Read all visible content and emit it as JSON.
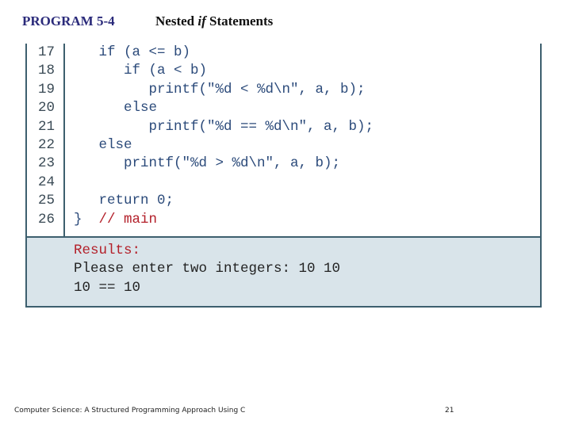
{
  "header": {
    "program_label": "PROGRAM 5-4",
    "title_prefix": "Nested ",
    "title_keyword": "if",
    "title_suffix": " Statements"
  },
  "code": {
    "lines": [
      {
        "num": "17",
        "text": "   if (a <= b)",
        "comment": ""
      },
      {
        "num": "18",
        "text": "      if (a < b)",
        "comment": ""
      },
      {
        "num": "19",
        "text": "         printf(\"%d < %d\\n\", a, b);",
        "comment": ""
      },
      {
        "num": "20",
        "text": "      else",
        "comment": ""
      },
      {
        "num": "21",
        "text": "         printf(\"%d == %d\\n\", a, b);",
        "comment": ""
      },
      {
        "num": "22",
        "text": "   else",
        "comment": ""
      },
      {
        "num": "23",
        "text": "      printf(\"%d > %d\\n\", a, b);",
        "comment": ""
      },
      {
        "num": "24",
        "text": "",
        "comment": ""
      },
      {
        "num": "25",
        "text": "   return 0;",
        "comment": ""
      },
      {
        "num": "26",
        "text": "}  ",
        "comment": "// main"
      }
    ]
  },
  "results": {
    "label": "Results:",
    "lines": [
      "Please enter two integers: 10 10",
      "10 == 10"
    ]
  },
  "footer": {
    "book": "Computer Science: A Structured Programming Approach Using C",
    "page": "21"
  },
  "colors": {
    "code": "#2b4a7a",
    "comment": "#b3202a",
    "results_bg": "#d9e4ea",
    "border": "#3d5f6e",
    "program_label": "#2a2a7a"
  }
}
